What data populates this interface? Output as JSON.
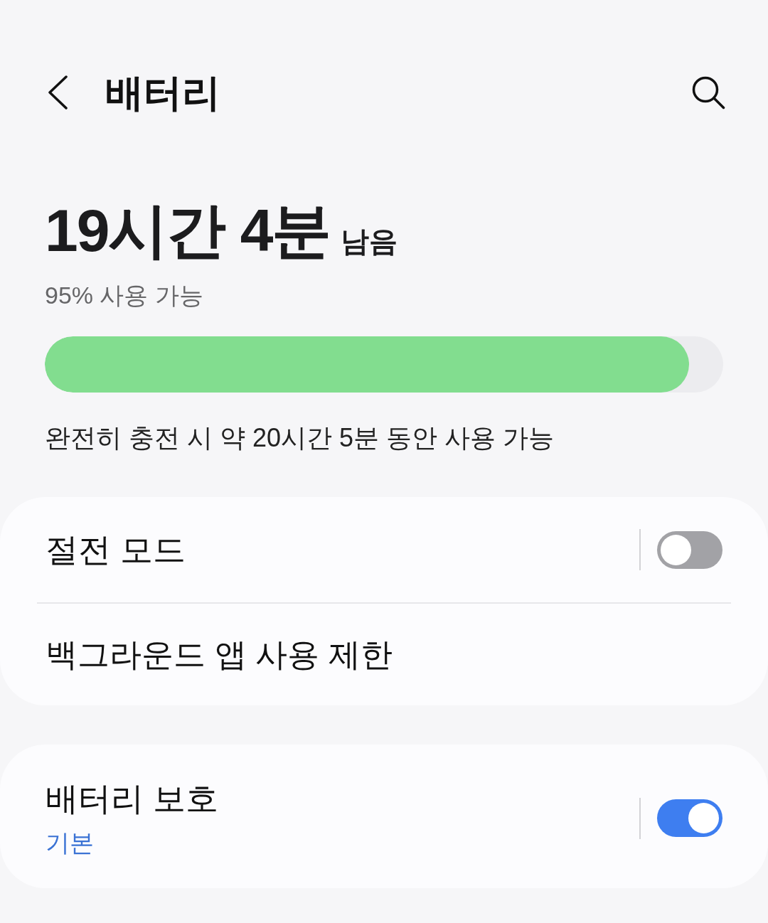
{
  "header": {
    "title": "배터리"
  },
  "summary": {
    "remaining": "19시간 4분",
    "remaining_suffix": "남음",
    "available": "95% 사용 가능",
    "level": 0.95,
    "full_charge": "완전히 충전 시 약 20시간 5분 동안 사용 가능"
  },
  "groups": [
    {
      "items": [
        {
          "kind": "toggle",
          "label": "절전 모드",
          "on": false
        },
        {
          "kind": "link",
          "label": "백그라운드 앱 사용 제한"
        }
      ]
    },
    {
      "items": [
        {
          "kind": "toggle",
          "label": "배터리 보호",
          "subtitle": "기본",
          "on": true
        }
      ]
    }
  ]
}
